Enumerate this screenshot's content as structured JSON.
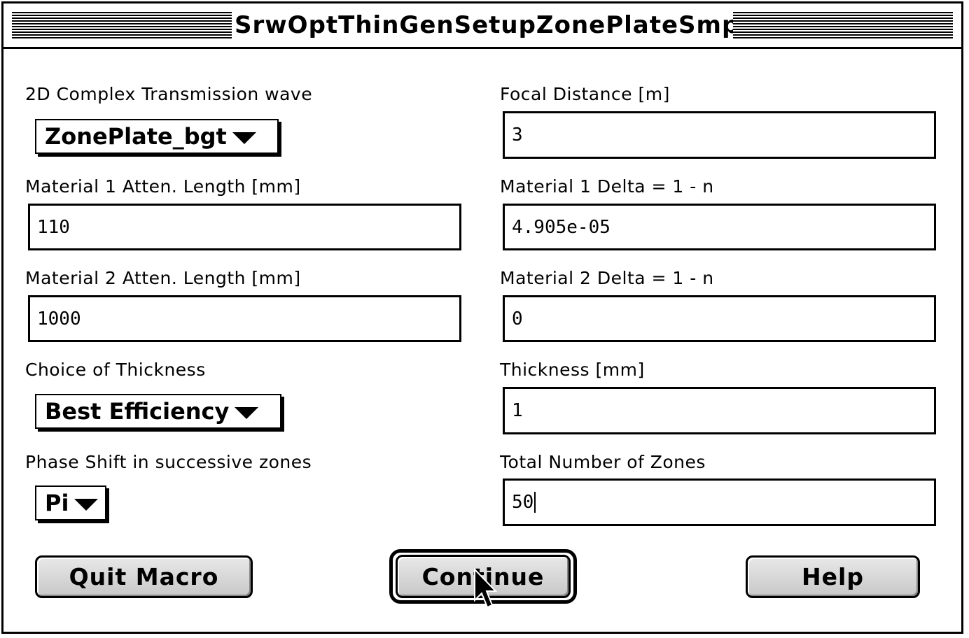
{
  "window": {
    "title": "SrwOptThinGenSetupZonePlateSmpl"
  },
  "left": {
    "wave_label": "2D Complex Transmission wave",
    "wave_value": "ZonePlate_bgt",
    "mat1_atten_label": "Material 1  Atten. Length [mm]",
    "mat1_atten_value": "110",
    "mat2_atten_label": "Material 2  Atten. Length [mm]",
    "mat2_atten_value": "1000",
    "thickness_choice_label": "Choice of Thickness",
    "thickness_choice_value": "Best Efficiency",
    "phase_shift_label": "Phase Shift in successive zones",
    "phase_shift_value": "Pi"
  },
  "right": {
    "focal_label": "Focal Distance [m]",
    "focal_value": "3",
    "mat1_delta_label": "Material 1 Delta = 1 - n",
    "mat1_delta_value": "4.905e-05",
    "mat2_delta_label": "Material 2 Delta = 1 - n",
    "mat2_delta_value": "0",
    "thickness_label": "Thickness [mm]",
    "thickness_value": "1",
    "zones_label": "Total Number of Zones",
    "zones_value": "50"
  },
  "buttons": {
    "quit": "Quit Macro",
    "continue": "Continue",
    "help": "Help"
  },
  "icons": {
    "dropdown": "triangle-down-icon",
    "cursor": "arrow-cursor-icon"
  }
}
